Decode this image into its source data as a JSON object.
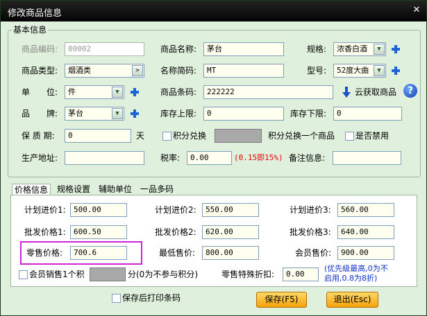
{
  "window": {
    "title": "修改商品信息",
    "close": "✕"
  },
  "basic": {
    "legend": "基本信息",
    "code": {
      "label": "商品编码:",
      "value": "00002"
    },
    "name": {
      "label": "商品名称:",
      "value": "茅台"
    },
    "spec": {
      "label": "规格:",
      "value": "浓香白酒"
    },
    "type": {
      "label": "商品类型:",
      "value": "烟酒类",
      "btn": ">"
    },
    "short": {
      "label": "名称简码:",
      "value": "MT"
    },
    "model": {
      "label": "型号:",
      "value": "52度大曲"
    },
    "unit": {
      "label": "单　　位:",
      "value": "件"
    },
    "barcode": {
      "label": "商品条码:",
      "value": "222222",
      "cloud": "云获取商品"
    },
    "brand": {
      "label": "品　　牌:",
      "value": "茅台"
    },
    "stock_max": {
      "label": "库存上限:",
      "value": "0"
    },
    "stock_min": {
      "label": "库存下限:",
      "value": "0"
    },
    "shelf": {
      "label": "保 质 期:",
      "value": "0",
      "unit": "天"
    },
    "points_redeem": {
      "label": "积分兑换",
      "value": "",
      "suffix": "积分兑换一个商品"
    },
    "disabled": {
      "label": "是否禁用"
    },
    "origin": {
      "label": "生产地址:",
      "value": ""
    },
    "tax": {
      "label": "税率:",
      "value": "0.00",
      "note": "(0.15即15%)"
    },
    "remark": {
      "label": "备注信息:",
      "value": ""
    }
  },
  "tabs": [
    "价格信息",
    "规格设置",
    "辅助单位",
    "一品多码"
  ],
  "price": {
    "plan1": {
      "label": "计划进价1:",
      "value": "500.00"
    },
    "plan2": {
      "label": "计划进价2:",
      "value": "550.00"
    },
    "plan3": {
      "label": "计划进价3:",
      "value": "560.00"
    },
    "whole1": {
      "label": "批发价格1:",
      "value": "600.50"
    },
    "whole2": {
      "label": "批发价格2:",
      "value": "620.00"
    },
    "whole3": {
      "label": "批发价格3:",
      "value": "640.00"
    },
    "retail": {
      "label": "零售价格:",
      "value": "700.6"
    },
    "min": {
      "label": "最低售价:",
      "value": "800.00"
    },
    "member": {
      "label": "会员售价:",
      "value": "900.00"
    },
    "member_points": {
      "label": "会员销售1个积",
      "value": "",
      "suffix": "分(0为不参与积分)"
    },
    "discount": {
      "label": "零售特殊折扣:",
      "value": "0.00",
      "note1": "(优先级最高,0为不",
      "note2": "启用,0.8为8折)"
    }
  },
  "footer": {
    "print_label": "保存后打印条码",
    "save": "保存(F5)",
    "exit": "退出(Esc)"
  }
}
